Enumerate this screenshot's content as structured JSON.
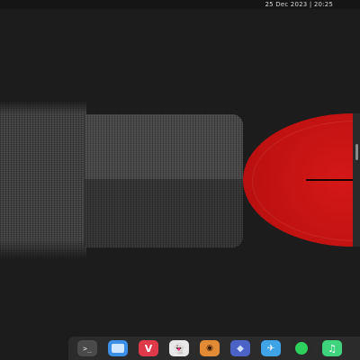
{
  "topbar": {
    "datetime": "25 Dec 2023 | 20:25"
  },
  "dock": {
    "items": [
      {
        "name": "terminal-icon",
        "glyph": ">_"
      },
      {
        "name": "files-icon",
        "glyph": ""
      },
      {
        "name": "vivaldi-icon",
        "glyph": "V"
      },
      {
        "name": "ghost-icon",
        "glyph": "👻"
      },
      {
        "name": "orange-app-icon",
        "glyph": "◉"
      },
      {
        "name": "blue-app-icon",
        "glyph": "◆"
      },
      {
        "name": "sky-app-icon",
        "glyph": "✈"
      },
      {
        "name": "spotify-icon",
        "glyph": ""
      },
      {
        "name": "music-icon",
        "glyph": "♫"
      }
    ]
  }
}
